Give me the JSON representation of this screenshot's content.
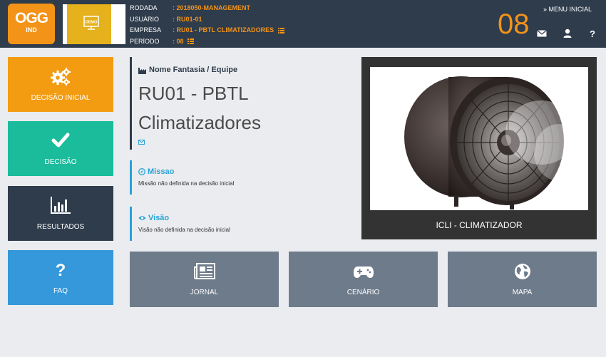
{
  "header": {
    "logo": {
      "main": "OGG",
      "sub": "IND"
    },
    "demo_badge": "DEMO",
    "info": [
      {
        "label": "RODADA",
        "value": ": 2018050-MANAGEMENT"
      },
      {
        "label": "USUÁRIO",
        "value": ": RU01-01"
      },
      {
        "label": "EMPRESA",
        "value": ": RU01 - PBTL CLIMATIZADORES"
      },
      {
        "label": "PERÍODO",
        "value": ": 08"
      }
    ],
    "period_big": "08",
    "menu_link": "» MENU INICIAL",
    "icons": [
      "envelope-icon",
      "user-icon",
      "question-icon"
    ]
  },
  "sidebar": {
    "tiles": [
      {
        "label": "DECISÃO INICIAL",
        "icon": "gears-icon",
        "color": "#f39c12"
      },
      {
        "label": "DECISÃO",
        "icon": "check-icon",
        "color": "#1abc9c"
      },
      {
        "label": "RESULTADOS",
        "icon": "bar-chart-icon",
        "color": "#2f3c4c"
      },
      {
        "label": "FAQ",
        "icon": "question-icon",
        "color": "#3498db"
      }
    ]
  },
  "main": {
    "team_title": "Nome Fantasia / Equipe",
    "team_name": "RU01 - PBTL Climatizadores",
    "mission_title": "Missao",
    "mission_text": "Missão não definida na decisão inicial",
    "vision_title": "Visão",
    "vision_text": "Visão não definida na decisão inicial"
  },
  "product": {
    "label": "ICLI - CLIMATIZADOR",
    "image": "industrial-fan-image"
  },
  "bottom_tiles": [
    {
      "label": "JORNAL",
      "icon": "newspaper-icon"
    },
    {
      "label": "CENÁRIO",
      "icon": "gamepad-icon"
    },
    {
      "label": "MAPA",
      "icon": "globe-icon"
    }
  ],
  "colors": {
    "header_bg": "#2f3c4c",
    "accent_orange": "#f39317",
    "page_bg": "#eaecef",
    "cyan": "#29a3d6",
    "tile_gray": "#6e7b8b"
  }
}
